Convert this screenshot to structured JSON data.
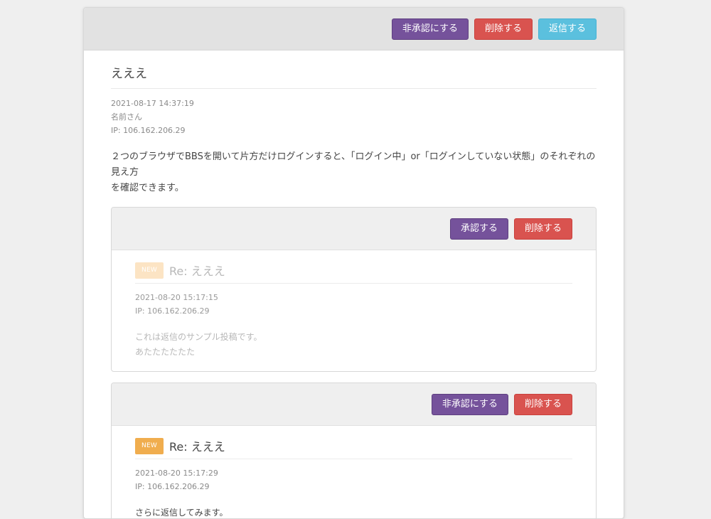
{
  "main_post": {
    "buttons": {
      "unapprove": "非承認にする",
      "delete": "削除する",
      "reply": "返信する"
    },
    "title": "えええ",
    "datetime": "2021-08-17 14:37:19",
    "author": "名前さん",
    "ip": "IP: 106.162.206.29",
    "body_line1": "２つのブラウザでBBSを開いて片方だけログインすると、「ログイン中」or「ログインしていない状態」のそれぞれの見え方",
    "body_line2": "を確認できます。"
  },
  "replies": [
    {
      "state": "unapproved",
      "buttons": {
        "approve": "承認する",
        "delete": "削除する"
      },
      "badge": "NEW",
      "title": "Re: えええ",
      "datetime": "2021-08-20 15:17:15",
      "ip": "IP: 106.162.206.29",
      "body_line1": "これは返信のサンプル投稿です。",
      "body_line2": "あたたたたたた"
    },
    {
      "state": "approved",
      "buttons": {
        "unapprove": "非承認にする",
        "delete": "削除する"
      },
      "badge": "NEW",
      "title": "Re: えええ",
      "datetime": "2021-08-20 15:17:29",
      "ip": "IP: 106.162.206.29",
      "body_line1": "さらに返信してみます。"
    }
  ],
  "colors": {
    "purple": "#75529b",
    "red": "#d9534f",
    "cyan": "#5bc0de",
    "badge_orange": "#f0ad4e"
  }
}
